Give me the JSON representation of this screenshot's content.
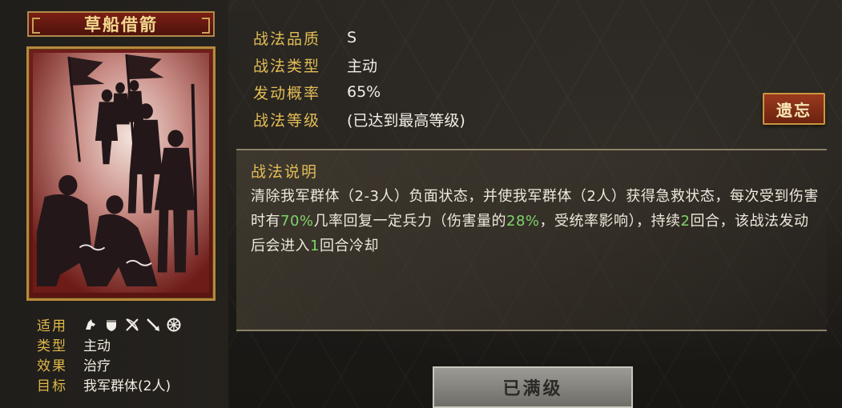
{
  "skill_name": "草船借箭",
  "meta": {
    "applicable_label": "适用",
    "applicable_icons": [
      "cavalry-icon",
      "shield-icon",
      "bow-icon",
      "spear-icon",
      "wheel-icon"
    ],
    "type_label": "类型",
    "type_value": "主动",
    "effect_label": "效果",
    "effect_value": "治疗",
    "target_label": "目标",
    "target_value": "我军群体(2人)"
  },
  "info": {
    "quality_label": "战法品质",
    "quality_value": "S",
    "kind_label": "战法类型",
    "kind_value": "主动",
    "rate_label": "发动概率",
    "rate_value": "65%",
    "level_label": "战法等级",
    "level_value": "(已达到最高等级)"
  },
  "forget_button": "遗忘",
  "description": {
    "title": "战法说明",
    "seg1": "清除我军群体（2-3人）负面状态，并使我军群体（2人）获得急救状态，每次受到伤害时有",
    "seg2": "70%",
    "seg3": "几率回复一定兵力（伤害量的",
    "seg4": "28%",
    "seg5": "，受统率影响），持续",
    "seg6": "2",
    "seg7": "回合，该战法发动后会进入",
    "seg8": "1",
    "seg9": "回合冷却"
  },
  "max_level_button": "已满级",
  "colors": {
    "gold_label": "#e2bd56",
    "highlight_green": "#7fd36b",
    "banner_red": "#7a1f14"
  }
}
